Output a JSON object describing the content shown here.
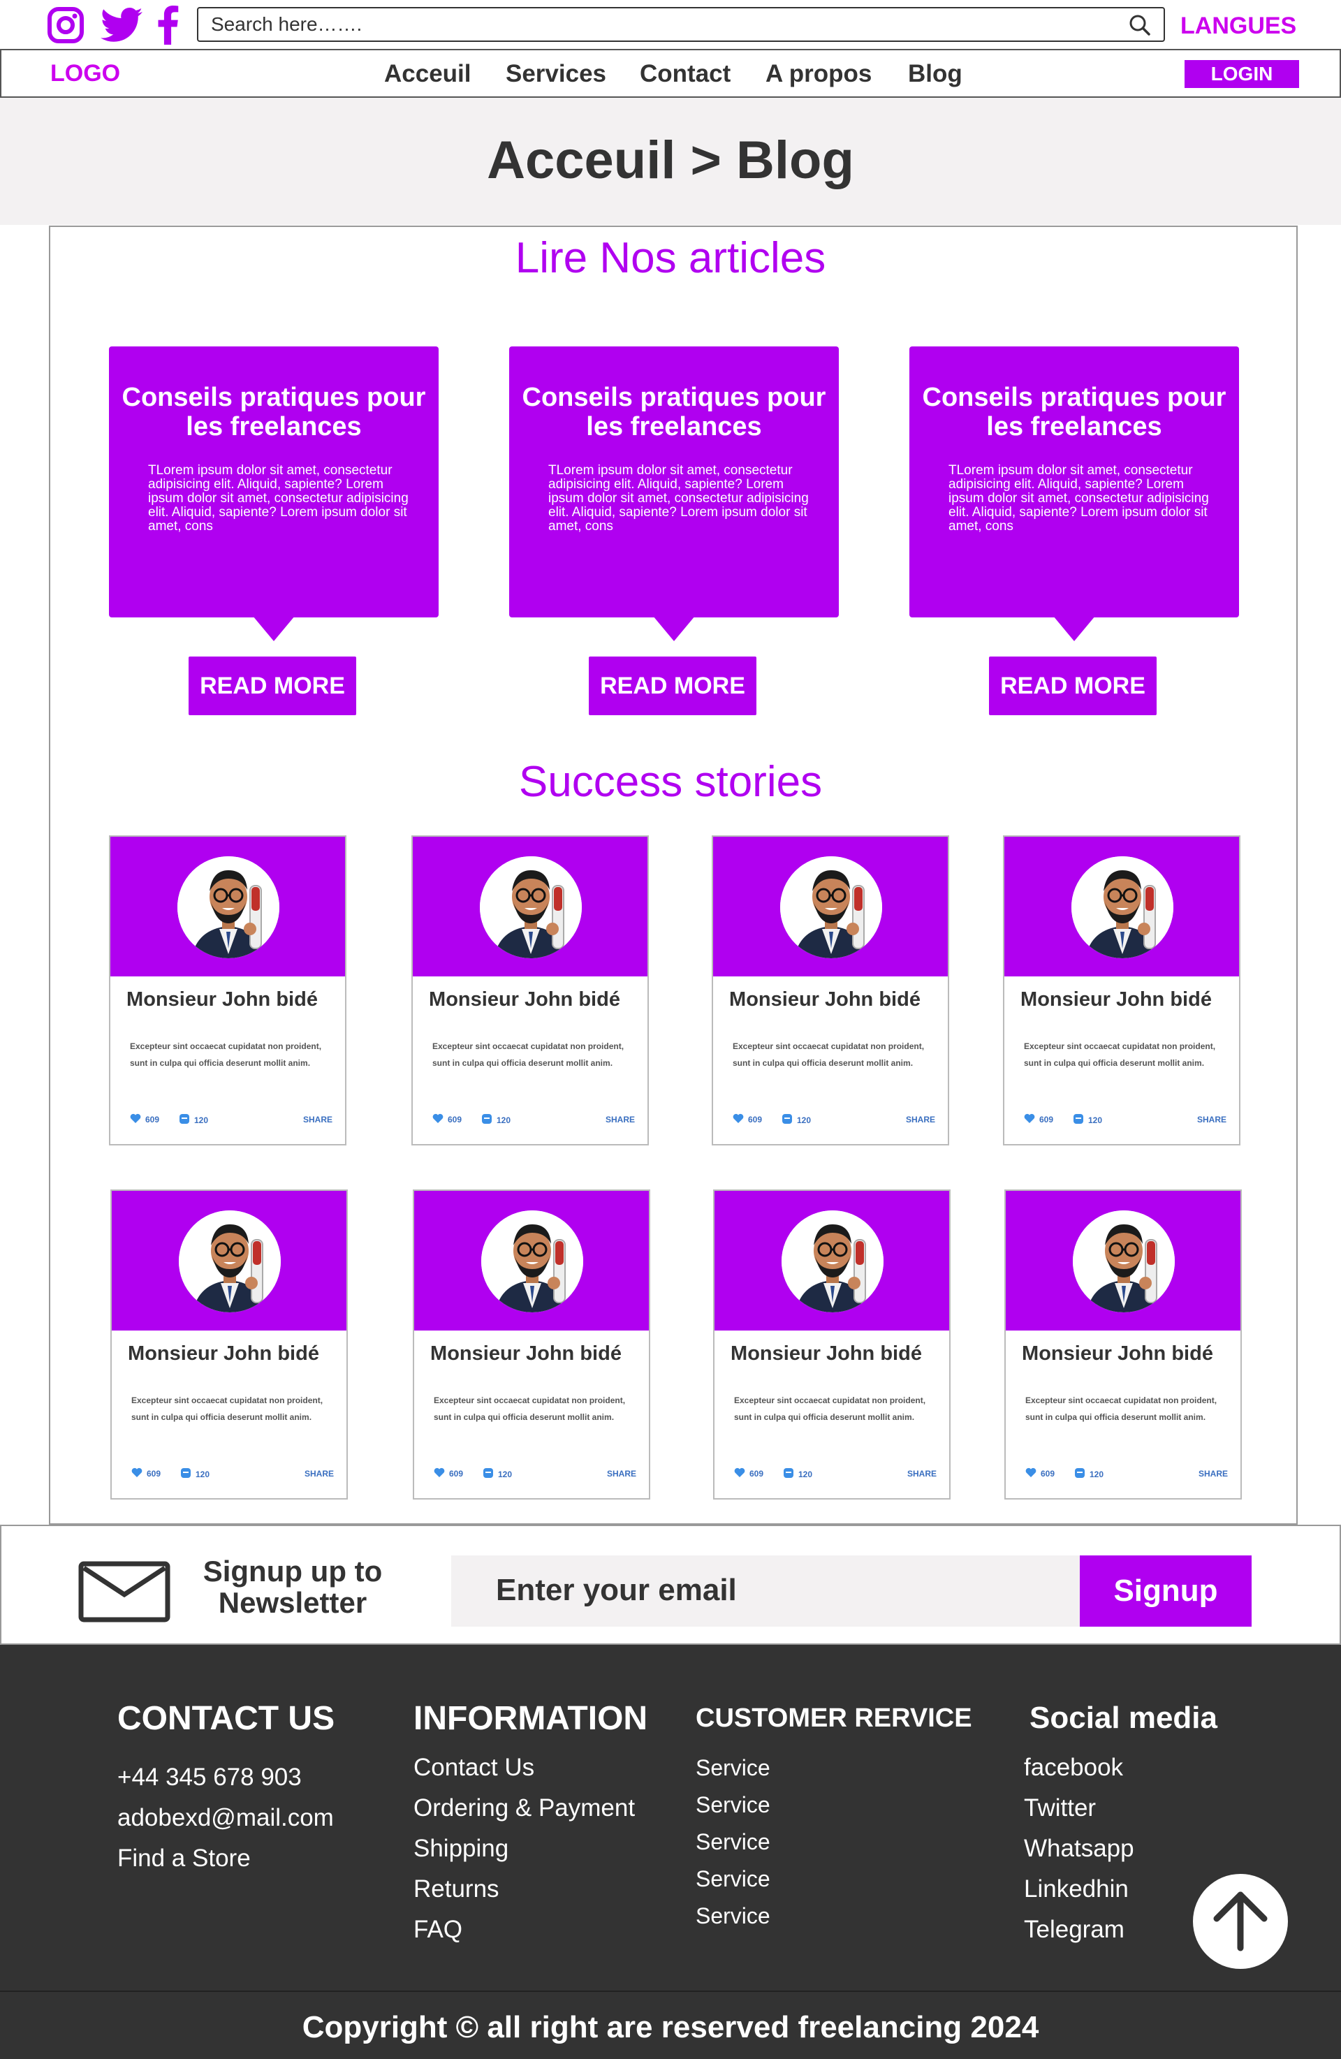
{
  "topbar": {
    "social_icons": [
      "instagram-icon",
      "twitter-icon",
      "facebook-icon"
    ],
    "search_placeholder": "Search here…….",
    "langues": "LANGUES"
  },
  "nav": {
    "logo": "LOGO",
    "links": [
      "Acceuil",
      "Services",
      "Contact",
      "A propos",
      "Blog"
    ],
    "login": "LOGIN"
  },
  "hero": {
    "breadcrumb": "Acceuil > Blog"
  },
  "articles": {
    "title": "Lire Nos articles",
    "items": [
      {
        "title": "Conseils pratiques pour les freelances",
        "body": "TLorem ipsum dolor sit amet, consectetur adipisicing elit. Aliquid, sapiente? Lorem ipsum dolor sit amet, consectetur adipisicing elit. Aliquid, sapiente? Lorem ipsum dolor sit amet, cons",
        "button": "READ MORE"
      },
      {
        "title": "Conseils pratiques pour les freelances",
        "body": "TLorem ipsum dolor sit amet, consectetur adipisicing elit. Aliquid, sapiente? Lorem ipsum dolor sit amet, consectetur adipisicing elit. Aliquid, sapiente? Lorem ipsum dolor sit amet, cons",
        "button": "READ MORE"
      },
      {
        "title": "Conseils pratiques pour les freelances",
        "body": "TLorem ipsum dolor sit amet, consectetur adipisicing elit. Aliquid, sapiente? Lorem ipsum dolor sit amet, consectetur adipisicing elit. Aliquid, sapiente? Lorem ipsum dolor sit amet, cons",
        "button": "READ MORE"
      }
    ]
  },
  "stories": {
    "title": "Success stories",
    "card": {
      "name": "Monsieur John  bidé",
      "desc": "Excepteur sint occaecat cupidatat non proident, sunt in culpa qui officia deserunt mollit anim.",
      "likes": "609",
      "comments": "120",
      "share": "SHARE"
    },
    "count": 8
  },
  "newsletter": {
    "title": "Signup up to Newsletter",
    "email_placeholder": "Enter your email",
    "button": "Signup"
  },
  "footer": {
    "contact": {
      "title": "CONTACT US",
      "items": [
        "+44 345 678 903",
        "adobexd@mail.com",
        "Find a Store"
      ]
    },
    "information": {
      "title": "INFORMATION",
      "items": [
        "Contact Us",
        "Ordering & Payment",
        "Shipping",
        "Returns",
        "FAQ"
      ]
    },
    "customer": {
      "title": "CUSTOMER RERVICE",
      "items": [
        "Service",
        "Service",
        "Service",
        "Service",
        "Service"
      ]
    },
    "social": {
      "title": "Social media",
      "items": [
        "facebook",
        "Twitter",
        "Whatsapp",
        "Linkedhin",
        "Telegram"
      ]
    },
    "copyright": "Copyright © all right are reserved freelancing 2024"
  },
  "colors": {
    "accent": "#b000f0",
    "footer_bg": "#333333",
    "hero_bg": "#f3f1f2"
  }
}
